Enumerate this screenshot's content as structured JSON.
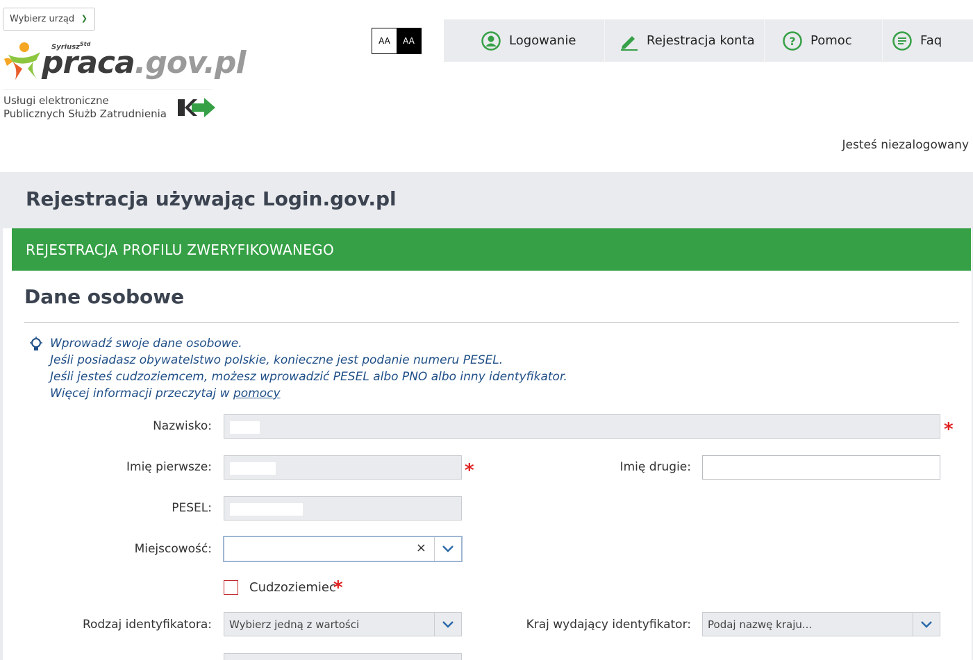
{
  "header": {
    "office_button": "Wybierz urząd",
    "logo": {
      "syriusz": "Syriusz",
      "syriusz_sup": "Std",
      "name_a": "praca",
      "name_b": ".gov.pl"
    },
    "services_line1": "Usługi elektroniczne",
    "services_line2": "Publicznych Służb Zatrudnienia",
    "font_switch": {
      "normal": "AA",
      "contrast": "AA"
    },
    "nav": {
      "login": "Logowanie",
      "register": "Rejestracja konta",
      "help": "Pomoc",
      "faq": "Faq"
    },
    "status": "Jesteś niezalogowany"
  },
  "page": {
    "title": "Rejestracja używając Login.gov.pl",
    "card_header": "REJESTRACJA PROFILU ZWERYFIKOWANEGO",
    "section_title": "Dane osobowe",
    "hint": {
      "line1": "Wprowadź swoje dane osobowe.",
      "line2": "Jeśli posiadasz obywatelstwo polskie, konieczne jest podanie numeru PESEL.",
      "line3": "Jeśli jesteś cudzoziemcem, możesz wprowadzić PESEL albo PNO albo inny identyfikator.",
      "line4_prefix": "Więcej informacji przeczytaj w ",
      "line4_link": "pomocy"
    }
  },
  "form": {
    "surname_label": "Nazwisko:",
    "first_name_label": "Imię pierwsze:",
    "second_name_label": "Imię drugie:",
    "pesel_label": "PESEL:",
    "city_label": "Miejscowość:",
    "foreigner_label": "Cudzoziemiec",
    "id_type_label": "Rodzaj identyfikatora:",
    "id_type_placeholder": "Wybierz jedną z wartości",
    "id_country_label": "Kraj wydający identyfikator:",
    "id_country_placeholder": "Podaj nazwę kraju...",
    "required_mark": "*",
    "clear_symbol": "×"
  },
  "colors": {
    "accent_green": "#36a046",
    "band_gray": "#e9ebee",
    "required_red": "#e02020",
    "hint_blue": "#1f4f87"
  },
  "icons": [
    "chevron-right-icon",
    "user-circle-icon",
    "pencil-icon",
    "question-circle-icon",
    "chat-icon",
    "lightbulb-icon",
    "chevron-down-icon",
    "clear-icon"
  ]
}
